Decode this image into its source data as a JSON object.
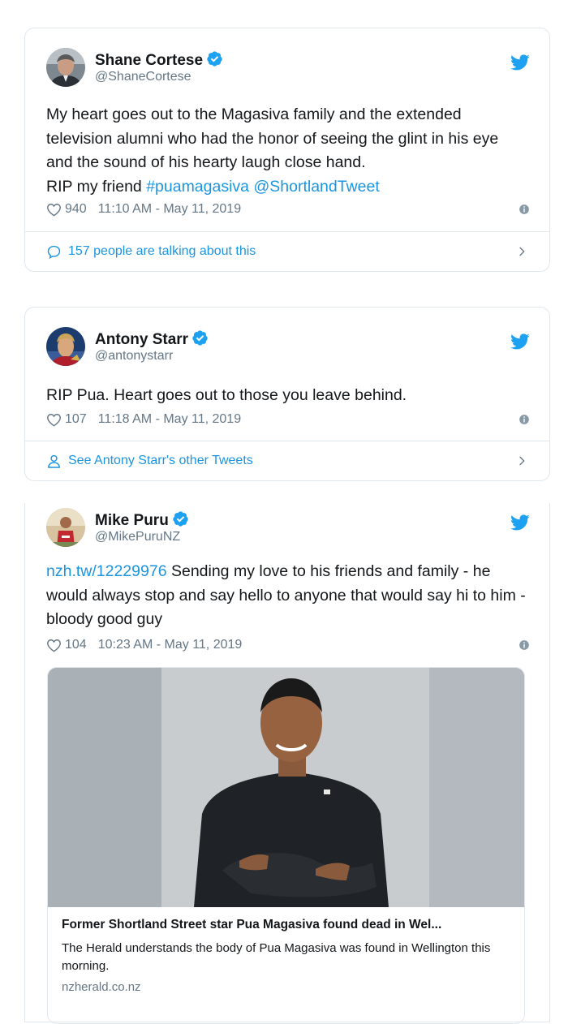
{
  "tweets": [
    {
      "name": "Shane Cortese",
      "handle": "@ShaneCortese",
      "text_lines": [
        "My heart goes out to the Magasiva family and the extended",
        "television alumni who had the honor of seeing the glint in his eye",
        "and the sound of his hearty laugh close hand."
      ],
      "text_last_prefix": "RIP my friend ",
      "hashtag": "#puamagasiva",
      "mention": "@ShortlandTweet",
      "likes": "940",
      "timestamp": "11:10 AM - May 11, 2019",
      "footer": "157 people are talking about this"
    },
    {
      "name": "Antony Starr",
      "handle": "@antonystarr",
      "text": "RIP Pua. Heart goes out to those you leave behind.",
      "likes": "107",
      "timestamp": "11:18 AM - May 11, 2019",
      "footer": "See Antony Starr's other Tweets"
    },
    {
      "name": "Mike Puru",
      "handle": "@MikePuruNZ",
      "link": "nzh.tw/12229976",
      "text_rest": " Sending my love to his friends and family - he would always stop and say hello to anyone that would say hi to him - bloody good guy",
      "likes": "104",
      "timestamp": "10:23 AM - May 11, 2019",
      "card": {
        "title": "Former Shortland Street star Pua Magasiva found dead in Wel...",
        "description": "The Herald understands the body of Pua Magasiva was found in Wellington this morning.",
        "domain": "nzherald.co.nz"
      }
    }
  ],
  "colors": {
    "twitter_blue": "#1da1f2",
    "link": "#1b95e0",
    "secondary_text": "#657786",
    "border": "#e1e8ed"
  },
  "icons": [
    "verified-badge-icon",
    "twitter-bird-icon",
    "heart-icon",
    "info-icon",
    "speech-bubble-icon",
    "person-icon",
    "chevron-right-icon"
  ]
}
